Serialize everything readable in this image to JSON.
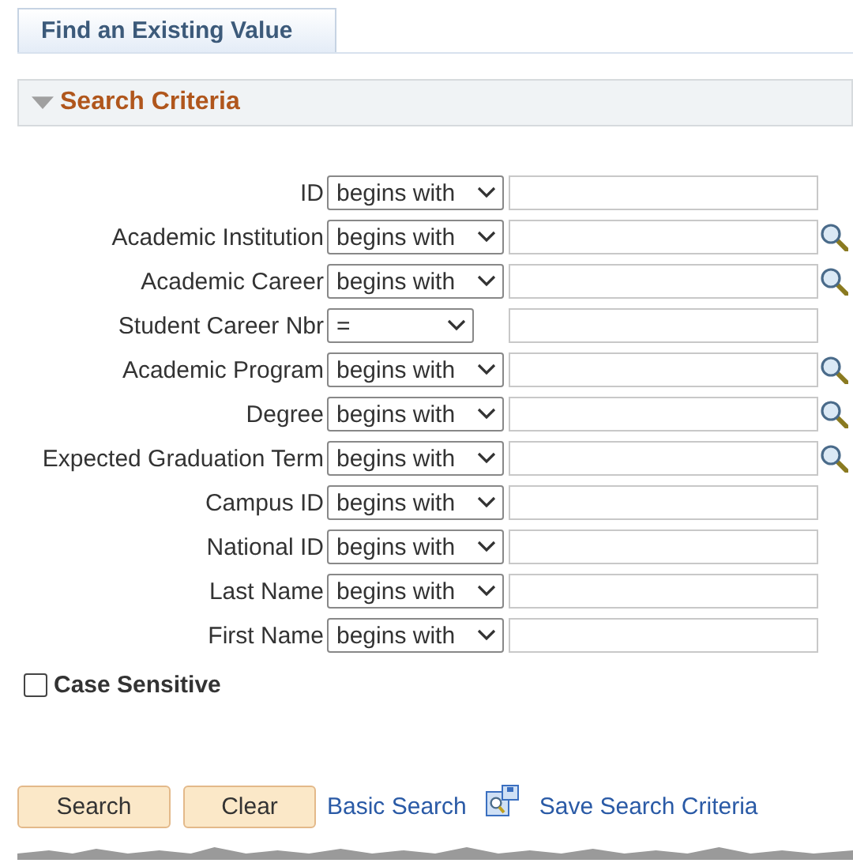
{
  "tabs": [
    {
      "label": "Find an Existing Value",
      "selected": true
    }
  ],
  "section": {
    "title": "Search Criteria",
    "expanded": true
  },
  "fields": [
    {
      "label": "ID",
      "operator": "begins with",
      "kind": "text",
      "lookup": false
    },
    {
      "label": "Academic Institution",
      "operator": "begins with",
      "kind": "text",
      "lookup": true
    },
    {
      "label": "Academic Career",
      "operator": "begins with",
      "kind": "text",
      "lookup": true
    },
    {
      "label": "Student Career Nbr",
      "operator": "=",
      "kind": "number",
      "lookup": false
    },
    {
      "label": "Academic Program",
      "operator": "begins with",
      "kind": "text",
      "lookup": true
    },
    {
      "label": "Degree",
      "operator": "begins with",
      "kind": "text",
      "lookup": true
    },
    {
      "label": "Expected Graduation Term",
      "operator": "begins with",
      "kind": "text",
      "lookup": true
    },
    {
      "label": "Campus ID",
      "operator": "begins with",
      "kind": "text",
      "lookup": false
    },
    {
      "label": "National ID",
      "operator": "begins with",
      "kind": "text",
      "lookup": false
    },
    {
      "label": "Last Name",
      "operator": "begins with",
      "kind": "text",
      "lookup": false
    },
    {
      "label": "First Name",
      "operator": "begins with",
      "kind": "text",
      "lookup": false
    }
  ],
  "case_sensitive": {
    "label": "Case Sensitive",
    "checked": false
  },
  "buttons": [
    "Search",
    "Clear"
  ],
  "links": [
    "Basic Search",
    "Save Search Criteria"
  ]
}
